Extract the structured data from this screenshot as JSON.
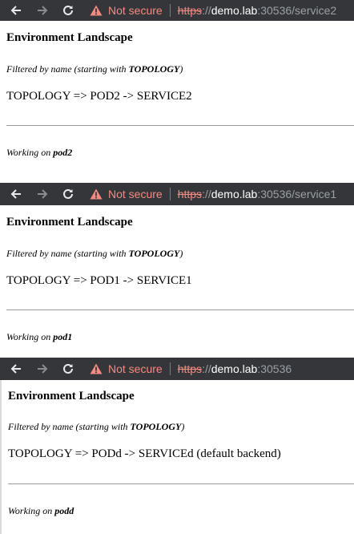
{
  "panels": [
    {
      "address": {
        "warning": "Not secure",
        "scheme": "https",
        "slashes": "://",
        "host": "demo.lab",
        "rest": ":30536/service2"
      },
      "heading": "Environment Landscape",
      "filter": {
        "prefix": "Filtered by name (starting with ",
        "term": "TOPOLOGY",
        "suffix": ")"
      },
      "route": "TOPOLOGY => POD2 -> SERVICE2",
      "working": {
        "prefix": "Working on ",
        "pod": "pod2"
      }
    },
    {
      "address": {
        "warning": "Not secure",
        "scheme": "https",
        "slashes": "://",
        "host": "demo.lab",
        "rest": ":30536/service1"
      },
      "heading": "Environment Landscape",
      "filter": {
        "prefix": "Filtered by name (starting with ",
        "term": "TOPOLOGY",
        "suffix": ")"
      },
      "route": "TOPOLOGY => POD1 -> SERVICE1",
      "working": {
        "prefix": "Working on ",
        "pod": "pod1"
      }
    },
    {
      "address": {
        "warning": "Not secure",
        "scheme": "https",
        "slashes": "://",
        "host": "demo.lab",
        "rest": ":30536"
      },
      "heading": "Environment Landscape",
      "filter": {
        "prefix": "Filtered by name (starting with ",
        "term": "TOPOLOGY",
        "suffix": ")"
      },
      "route": "TOPOLOGY => PODd -> SERVICEd (default backend)",
      "working": {
        "prefix": "Working on ",
        "pod": "podd"
      }
    }
  ],
  "icons": {
    "back": "arrow-left-icon",
    "forward": "arrow-right-icon",
    "reload": "reload-icon",
    "security": "warning-triangle-icon"
  },
  "colors": {
    "toolbar": "#35363a",
    "warning": "#f28b82",
    "host": "#ffffff",
    "path": "#9aa0a6"
  }
}
